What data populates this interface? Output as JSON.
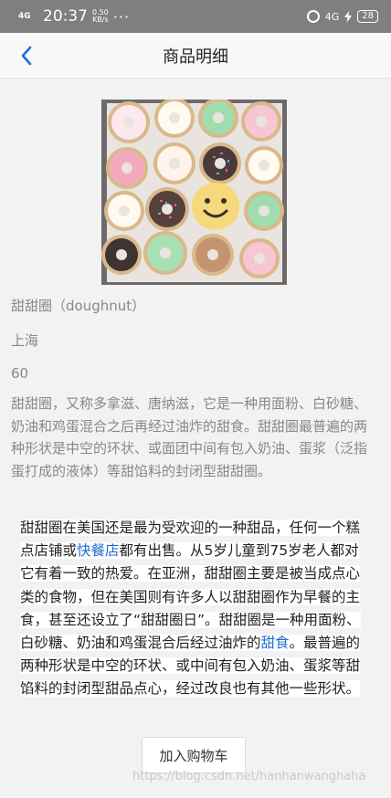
{
  "status_bar": {
    "network": "4G",
    "time": "20:37",
    "speed_value": "0.50",
    "speed_unit": "KB/s",
    "more": "···",
    "signal2": "4G",
    "battery": "28"
  },
  "nav": {
    "back_icon": "chevron-left-icon",
    "title": "商品明细"
  },
  "product": {
    "image": "donuts-box-photo",
    "name": "甜甜圈（doughnut）",
    "origin": "上海",
    "price": "60",
    "description": "甜甜圈，又称多拿滋、唐纳滋，它是一种用面粉、白砂糖、奶油和鸡蛋混合之后再经过油炸的甜食。甜甜圈最普遍的两种形状是中空的环状、或面团中间有包入奶油、蛋浆（泛指蛋打成的液体）等甜馅料的封闭型甜甜圈。"
  },
  "detail": {
    "p1": "甜甜圈在美国还是最为受欢迎的一种甜品，任何一个糕点店铺或",
    "link1": "快餐店",
    "p2": "都有出售。从5岁儿童到75岁老人都对它有着一致的热爱。在亚洲，甜甜圈主要是被当成点心类的食物，但在美国则有许多人以甜甜圈作为早餐的主食，甚至还设立了“甜甜圈日”。甜甜圈是一种用面粉、白砂糖、奶油和鸡蛋混合后经过油炸的",
    "link2": "甜食",
    "p3": "。最普遍的两种形状是中空的环状、或中间有包入奶油、蛋浆等甜馅料的封闭型甜品点心，经过改良也有其他一些形状。"
  },
  "actions": {
    "add_to_cart": "加入购物车"
  },
  "watermark": "https://blog.csdn.net/hanhanwanghaha",
  "colors": {
    "status_bar": "#7f7f7f",
    "accent": "#1d6fd2",
    "background": "#f2f2f2"
  }
}
